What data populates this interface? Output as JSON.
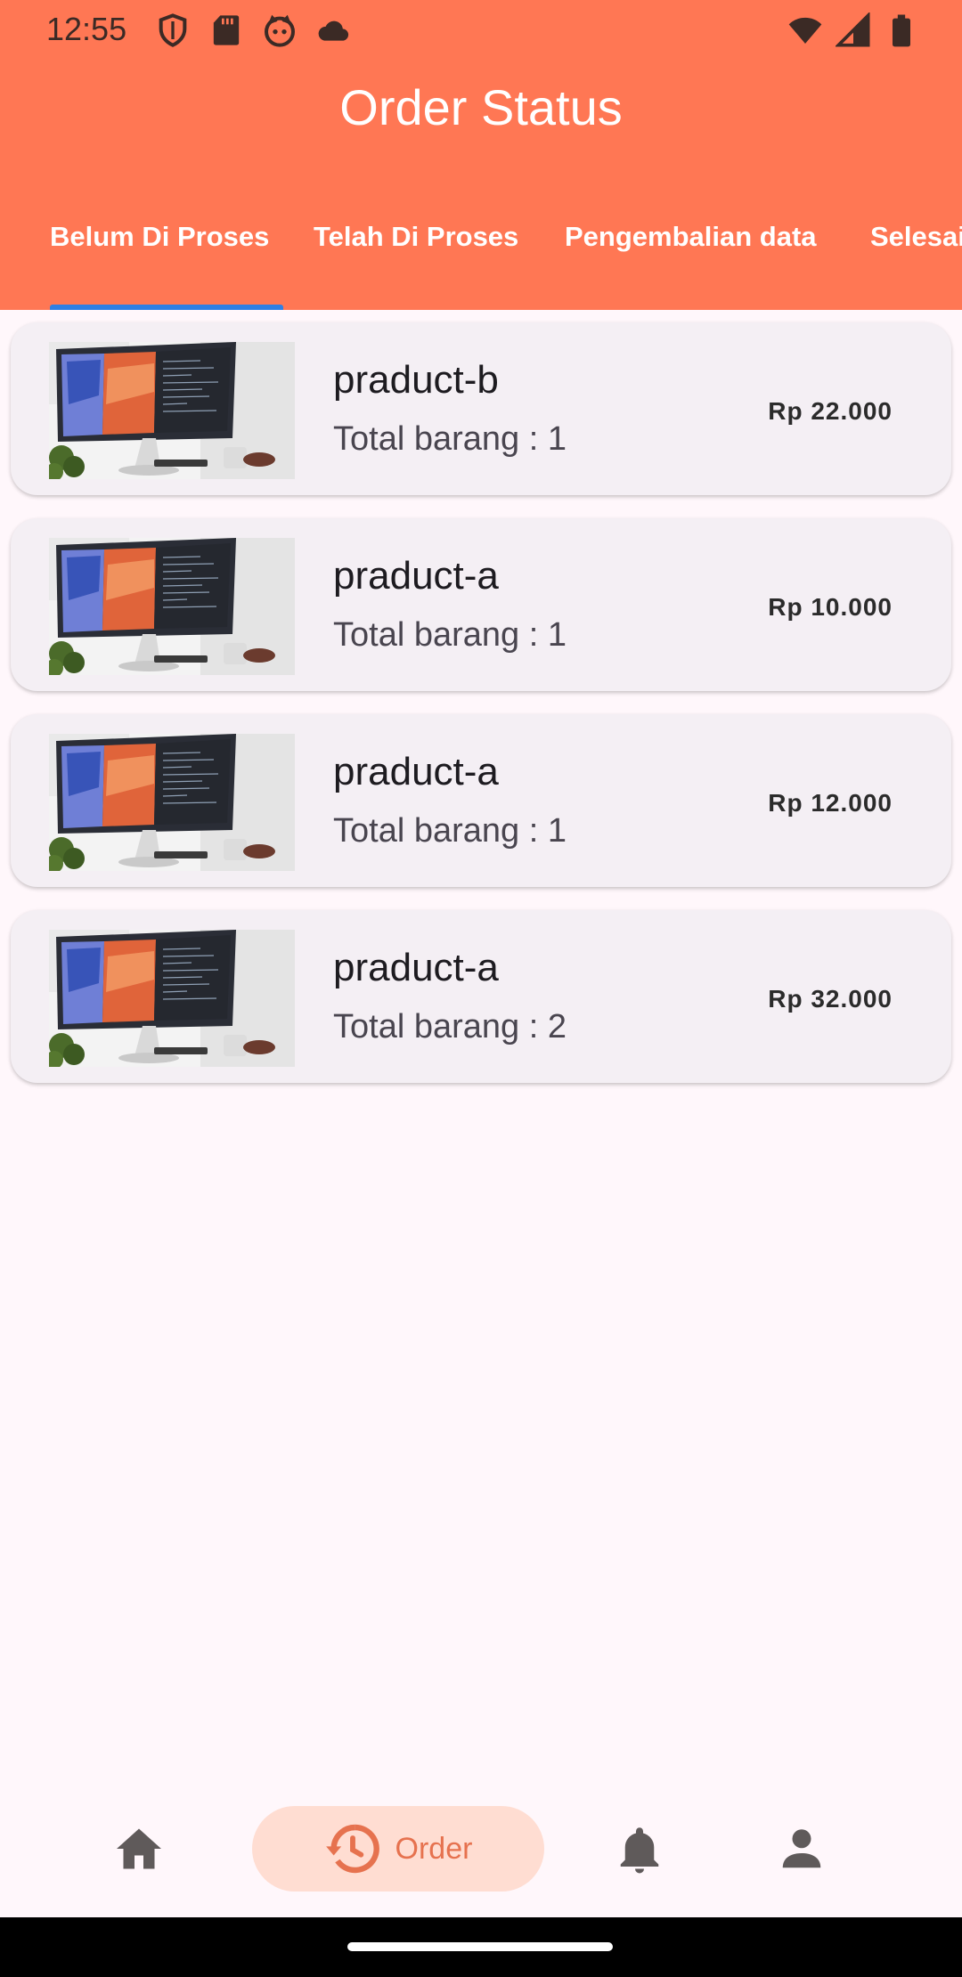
{
  "status_bar": {
    "time": "12:55",
    "left_icons": [
      "shield-icon",
      "sdcard-icon",
      "face-icon",
      "cloud-icon"
    ],
    "right_icons": [
      "wifi-icon",
      "signal-icon",
      "battery-icon"
    ]
  },
  "app_bar": {
    "title": "Order Status",
    "background": "#FF7754"
  },
  "tabs": [
    {
      "label": "Belum Di Proses",
      "selected": true
    },
    {
      "label": "Telah Di Proses",
      "selected": false
    },
    {
      "label": "Pengembalian data",
      "selected": false
    },
    {
      "label": "Selesai",
      "selected": false
    }
  ],
  "orders": [
    {
      "name": "praduct-b",
      "count_text": "Total barang : 1",
      "price": "Rp 22.000",
      "image": "monitor-product-image"
    },
    {
      "name": "praduct-a",
      "count_text": "Total barang : 1",
      "price": "Rp 10.000",
      "image": "monitor-product-image"
    },
    {
      "name": "praduct-a",
      "count_text": "Total barang : 1",
      "price": "Rp 12.000",
      "image": "monitor-product-image"
    },
    {
      "name": "praduct-a",
      "count_text": "Total barang : 2",
      "price": "Rp 32.000",
      "image": "monitor-product-image"
    }
  ],
  "bottom_nav": {
    "items": [
      {
        "icon": "home-icon",
        "label": "",
        "selected": false
      },
      {
        "icon": "history-icon",
        "label": "Order",
        "selected": true
      },
      {
        "icon": "bell-icon",
        "label": "",
        "selected": false
      },
      {
        "icon": "person-icon",
        "label": "",
        "selected": false
      }
    ]
  },
  "colors": {
    "accent": "#FF7754",
    "tab_indicator": "#2F7FE4",
    "nav_selected_bg": "#FFDDD2",
    "nav_selected_fg": "#E6724F"
  }
}
